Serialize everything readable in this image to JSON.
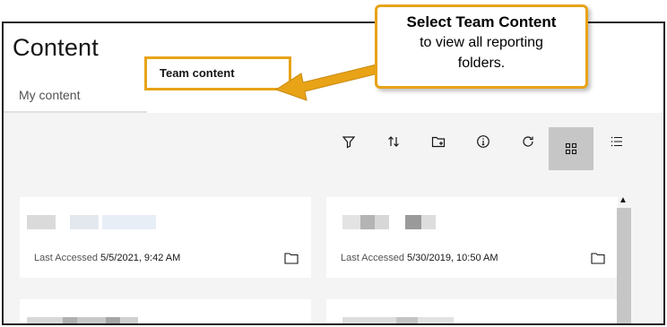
{
  "page": {
    "title": "Content"
  },
  "tabs": [
    {
      "label": "My content"
    },
    {
      "label": "Team content"
    }
  ],
  "toolbar": {
    "icons": [
      "filter-icon",
      "sort-icon",
      "new-folder-icon",
      "info-icon",
      "refresh-icon",
      "grid-view-icon",
      "list-view-icon"
    ]
  },
  "cards": [
    {
      "accessed_label": "Last Accessed",
      "accessed_value": "5/5/2021, 9:42 AM"
    },
    {
      "accessed_label": "Last Accessed",
      "accessed_value": "5/30/2019, 10:50 AM"
    }
  ],
  "callout": {
    "headline": "Select Team Content",
    "line1": "to view all reporting",
    "line2": "folders."
  },
  "colors": {
    "accent": "#e8a317",
    "selected_tool": "#c6c6c6",
    "content_bg": "#f4f4f4"
  }
}
